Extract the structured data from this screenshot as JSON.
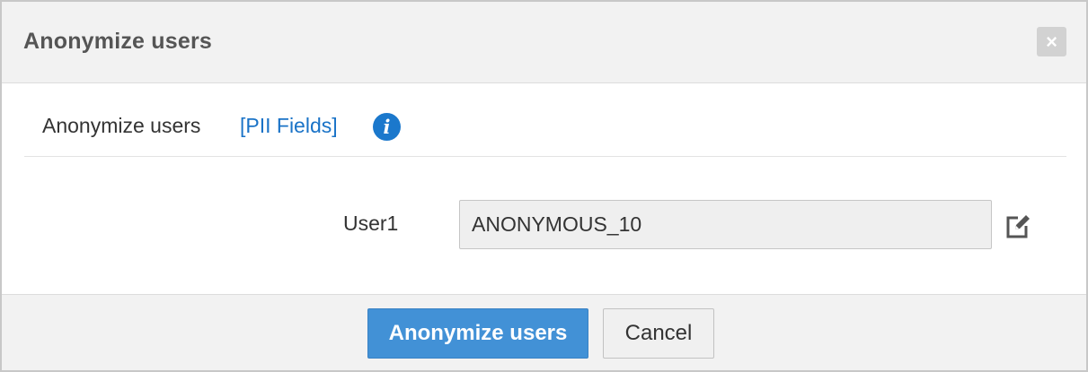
{
  "dialog": {
    "title": "Anonymize users",
    "close_label": "×"
  },
  "section": {
    "label": "Anonymize users",
    "pii_link": "[PII Fields]",
    "info_icon": "info-icon",
    "info_glyph": "i"
  },
  "form": {
    "user_label": "User1",
    "user_value": "ANONYMOUS_10",
    "edit_icon": "edit-icon"
  },
  "footer": {
    "primary_label": "Anonymize users",
    "cancel_label": "Cancel"
  },
  "colors": {
    "accent": "#4291d6",
    "link": "#1a73c7",
    "header_bg": "#f2f2f2"
  }
}
